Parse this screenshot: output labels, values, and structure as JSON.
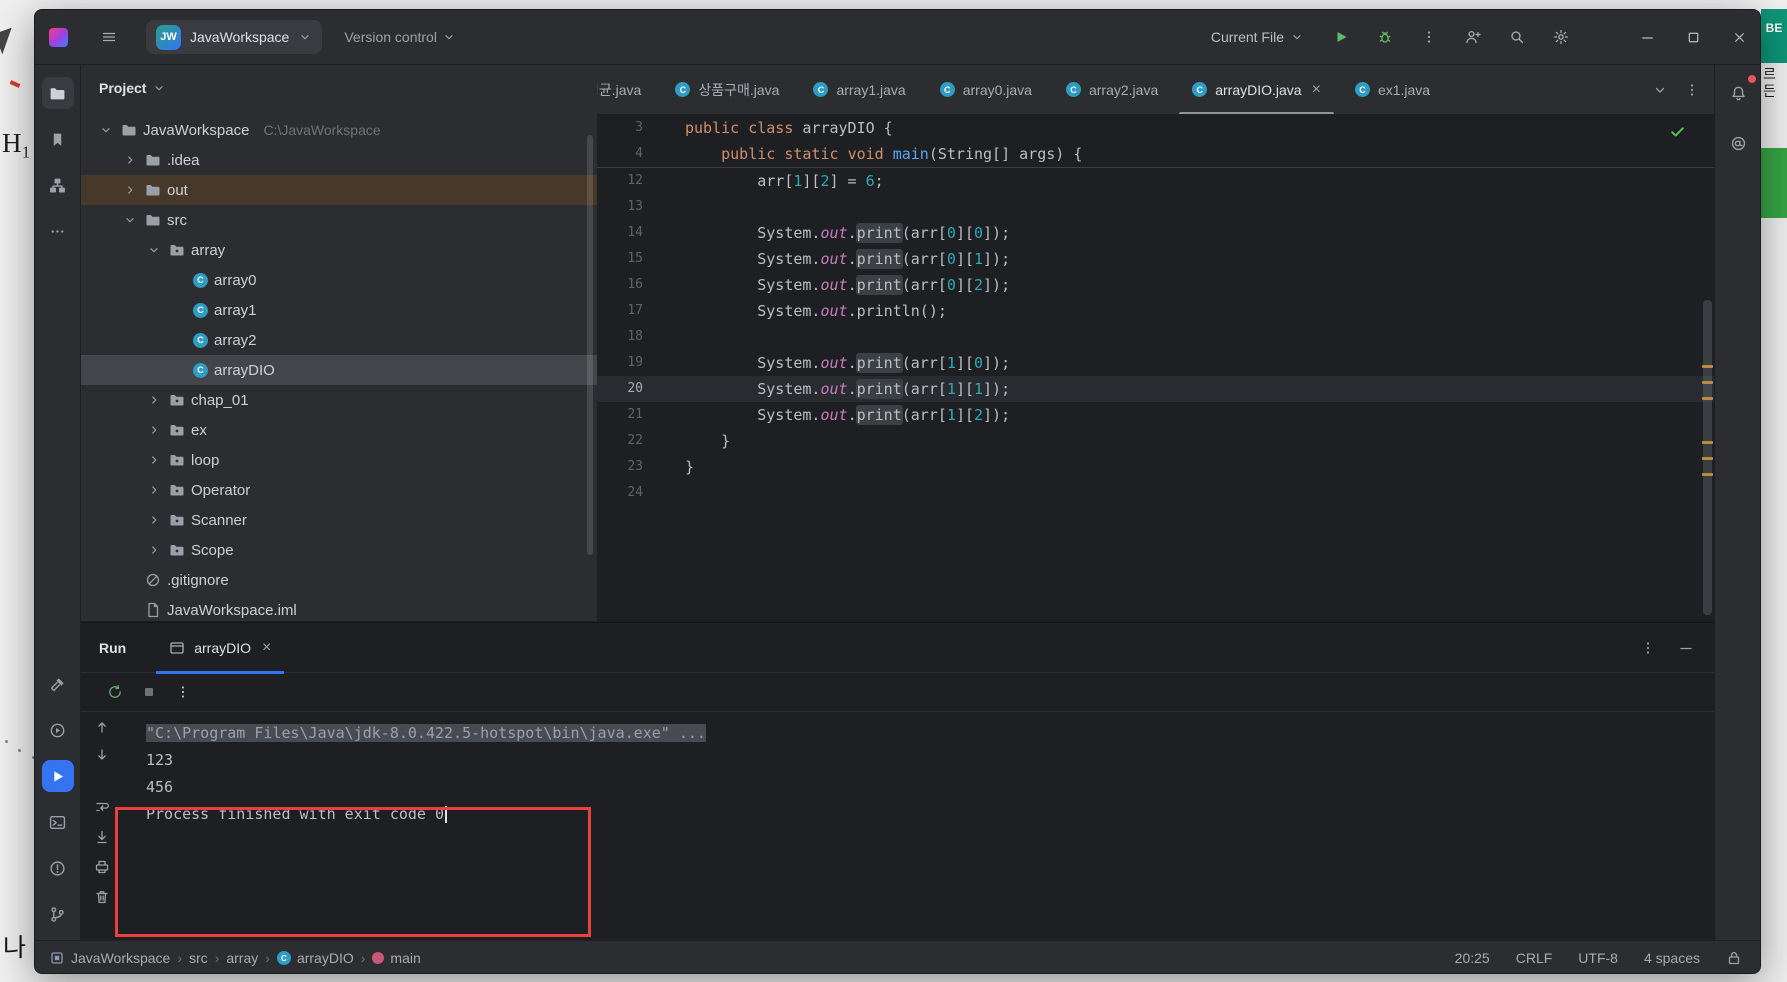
{
  "colors": {
    "accent_blue": "#3574f0",
    "keyword": "#cf8e6d",
    "number": "#2aacb8",
    "field": "#c77dbb",
    "method_decl": "#56a8f5",
    "annotation_red": "#e8403c",
    "run_green": "#5fb865",
    "check_green": "#57c457",
    "class_icon_blue": "#2e9cc3",
    "tree_selection": "#43454a",
    "out_row": "#47392a",
    "selection_console": "#474b52"
  },
  "titlebar": {
    "project_name": "JavaWorkspace",
    "project_avatar": "JW",
    "version_control_label": "Version control",
    "run_config_label": "Current File",
    "right_icons": [
      {
        "icon": "run",
        "name": "run-button",
        "cls": "green"
      },
      {
        "icon": "debug",
        "name": "debug-button",
        "cls": "green"
      },
      {
        "icon": "more-vertical",
        "name": "more-actions-button",
        "cls": ""
      },
      {
        "icon": "user-plus",
        "name": "code-with-me-button",
        "cls": ""
      },
      {
        "icon": "search",
        "name": "search-everywhere-button",
        "cls": ""
      },
      {
        "icon": "settings",
        "name": "settings-button",
        "cls": ""
      }
    ]
  },
  "left_stripe": {
    "top": [
      {
        "icon": "folder",
        "name": "project-tool-button",
        "active": true
      },
      {
        "icon": "bookmark",
        "name": "bookmarks-tool-button"
      },
      {
        "icon": "structure",
        "name": "structure-tool-button"
      },
      {
        "icon": "more-horizontal",
        "name": "more-tool-windows-button"
      }
    ],
    "bottom": [
      {
        "icon": "build",
        "name": "build-tool-button"
      },
      {
        "icon": "services",
        "name": "services-tool-button"
      },
      {
        "icon": "run-filled",
        "name": "run-tool-button",
        "accent": true
      },
      {
        "icon": "terminal",
        "name": "terminal-tool-button"
      },
      {
        "icon": "problems",
        "name": "problems-tool-button"
      },
      {
        "icon": "branch",
        "name": "version-control-tool-button"
      }
    ]
  },
  "right_stripe": {
    "icons": [
      {
        "icon": "bell",
        "name": "notifications-button",
        "badge": true
      },
      {
        "icon": "ai",
        "name": "ai-assistant-button"
      }
    ]
  },
  "project_panel": {
    "header": "Project",
    "tree": [
      {
        "label": "JavaWorkspace",
        "note": "C:\\JavaWorkspace",
        "depth": 0,
        "chevron": "down",
        "icon": "folder"
      },
      {
        "label": ".idea",
        "depth": 1,
        "chevron": "right",
        "icon": "folder"
      },
      {
        "label": "out",
        "depth": 1,
        "chevron": "right",
        "icon": "folder",
        "highlight": true
      },
      {
        "label": "src",
        "depth": 1,
        "chevron": "down",
        "icon": "folder"
      },
      {
        "label": "array",
        "depth": 2,
        "chevron": "down",
        "icon": "package"
      },
      {
        "label": "array0",
        "depth": 3,
        "icon": "class"
      },
      {
        "label": "array1",
        "depth": 3,
        "icon": "class"
      },
      {
        "label": "array2",
        "depth": 3,
        "icon": "class"
      },
      {
        "label": "arrayDIO",
        "depth": 3,
        "ic1on": "class",
        "icon": "class",
        "selected": true
      },
      {
        "label": "chap_01",
        "depth": 2,
        "chevron": "right",
        "icon": "package"
      },
      {
        "label": "ex",
        "depth": 2,
        "chevron": "right",
        "icon": "package"
      },
      {
        "label": "loop",
        "depth": 2,
        "chevron": "right",
        "icon": "package"
      },
      {
        "label": "Operator",
        "depth": 2,
        "chevron": "right",
        "icon": "package"
      },
      {
        "label": "Scanner",
        "depth": 2,
        "chevron": "right",
        "icon": "package"
      },
      {
        "label": "Scope",
        "depth": 2,
        "chevron": "right",
        "icon": "package"
      },
      {
        "label": ".gitignore",
        "depth": 1,
        "icon": "ignored"
      },
      {
        "label": "JavaWorkspace.iml",
        "depth": 1,
        "icon": "file"
      }
    ]
  },
  "editor": {
    "tabs": [
      {
        "label": "평균.java",
        "icon": false,
        "clipped": true
      },
      {
        "label": "상품구매.java",
        "icon": true
      },
      {
        "label": "array1.java",
        "icon": true
      },
      {
        "label": "array0.java",
        "icon": true
      },
      {
        "label": "array2.java",
        "icon": true
      },
      {
        "label": "arrayDIO.java",
        "icon": true,
        "active": true,
        "close": true
      },
      {
        "label": "ex1.java",
        "icon": true
      }
    ],
    "tabbar_icons": [
      {
        "icon": "chevron-down",
        "name": "hidden-tabs-chevron"
      },
      {
        "icon": "more-vertical",
        "name": "editor-options"
      }
    ],
    "sticky_lines": [
      {
        "num": "3",
        "seg": [
          [
            "k",
            "public"
          ],
          [
            "d",
            " "
          ],
          [
            "k",
            "class"
          ],
          [
            "d",
            " arrayDIO {"
          ]
        ]
      },
      {
        "num": "4",
        "seg": [
          [
            "d",
            "    "
          ],
          [
            "k",
            "public"
          ],
          [
            "d",
            " "
          ],
          [
            "k",
            "static"
          ],
          [
            "d",
            " "
          ],
          [
            "k",
            "void"
          ],
          [
            "d",
            " "
          ],
          [
            "m",
            "main"
          ],
          [
            "d",
            "(String[] args) {"
          ]
        ]
      }
    ],
    "lines": [
      {
        "num": "12",
        "seg": [
          [
            "d",
            "        arr["
          ],
          [
            "n",
            "1"
          ],
          [
            "d",
            "]["
          ],
          [
            "n",
            "2"
          ],
          [
            "d",
            "] = "
          ],
          [
            "n",
            "6"
          ],
          [
            "d",
            ";"
          ]
        ]
      },
      {
        "num": "13",
        "seg": []
      },
      {
        "num": "14",
        "seg": [
          [
            "d",
            "        System."
          ],
          [
            "f",
            "out"
          ],
          [
            "d",
            "."
          ],
          [
            "h",
            "print"
          ],
          [
            "d",
            "(arr["
          ],
          [
            "n",
            "0"
          ],
          [
            "d",
            "]["
          ],
          [
            "n",
            "0"
          ],
          [
            "d",
            "]);"
          ]
        ]
      },
      {
        "num": "15",
        "seg": [
          [
            "d",
            "        System."
          ],
          [
            "f",
            "out"
          ],
          [
            "d",
            "."
          ],
          [
            "h",
            "print"
          ],
          [
            "d",
            "(arr["
          ],
          [
            "n",
            "0"
          ],
          [
            "d",
            "]["
          ],
          [
            "n",
            "1"
          ],
          [
            "d",
            "]);"
          ]
        ]
      },
      {
        "num": "16",
        "seg": [
          [
            "d",
            "        System."
          ],
          [
            "f",
            "out"
          ],
          [
            "d",
            "."
          ],
          [
            "h",
            "print"
          ],
          [
            "d",
            "(arr["
          ],
          [
            "n",
            "0"
          ],
          [
            "d",
            "]["
          ],
          [
            "n",
            "2"
          ],
          [
            "d",
            "]);"
          ]
        ]
      },
      {
        "num": "17",
        "seg": [
          [
            "d",
            "        System."
          ],
          [
            "f",
            "out"
          ],
          [
            "d",
            ".println();"
          ]
        ]
      },
      {
        "num": "18",
        "seg": []
      },
      {
        "num": "19",
        "seg": [
          [
            "d",
            "        System."
          ],
          [
            "f",
            "out"
          ],
          [
            "d",
            "."
          ],
          [
            "h",
            "print"
          ],
          [
            "d",
            "(arr["
          ],
          [
            "n",
            "1"
          ],
          [
            "d",
            "]["
          ],
          [
            "n",
            "0"
          ],
          [
            "d",
            "]);"
          ]
        ]
      },
      {
        "num": "20",
        "cur": true,
        "seg": [
          [
            "d",
            "        System."
          ],
          [
            "f",
            "out"
          ],
          [
            "d",
            "."
          ],
          [
            "h",
            "print"
          ],
          [
            "d",
            "(arr["
          ],
          [
            "n",
            "1"
          ],
          [
            "d",
            "]["
          ],
          [
            "n",
            "1"
          ],
          [
            "d",
            "]);"
          ]
        ]
      },
      {
        "num": "21",
        "seg": [
          [
            "d",
            "        System."
          ],
          [
            "f",
            "out"
          ],
          [
            "d",
            "."
          ],
          [
            "h",
            "print"
          ],
          [
            "d",
            "(arr["
          ],
          [
            "n",
            "1"
          ],
          [
            "d",
            "]["
          ],
          [
            "n",
            "2"
          ],
          [
            "d",
            "]);"
          ]
        ]
      },
      {
        "num": "22",
        "seg": [
          [
            "d",
            "    }"
          ]
        ]
      },
      {
        "num": "23",
        "seg": [
          [
            "d",
            "}"
          ]
        ]
      },
      {
        "num": "24",
        "seg": []
      }
    ]
  },
  "run_panel": {
    "title": "Run",
    "tab_label": "arrayDIO",
    "toolbar_icons": [
      {
        "icon": "rerun",
        "name": "rerun-button",
        "cls": "green"
      },
      {
        "icon": "stop",
        "name": "stop-button",
        "cls": "dim"
      },
      {
        "icon": "more-vertical",
        "name": "more-options-button",
        "cls": ""
      }
    ],
    "header_icons": [
      {
        "icon": "more-vertical",
        "name": "run-panel-options-button"
      },
      {
        "icon": "minimize",
        "name": "hide-run-panel-button"
      }
    ],
    "gutter_icons": [
      {
        "icon": "scroll-up",
        "name": "scroll-up-button"
      },
      {
        "icon": "scroll-down",
        "name": "scroll-down-button"
      },
      {
        "icon": "soft-wrap",
        "name": "soft-wrap-button"
      },
      {
        "icon": "scroll-end",
        "name": "scroll-to-end-button"
      },
      {
        "icon": "printer",
        "name": "print-console-button"
      },
      {
        "icon": "trash",
        "name": "clear-console-button"
      }
    ],
    "console": [
      {
        "text": "\"C:\\Program Files\\Java\\jdk-8.0.422.5-hotspot\\bin\\java.exe\" ...",
        "selected": true
      },
      {
        "text": "123"
      },
      {
        "text": "456"
      },
      {
        "text": "Process finished with exit code 0",
        "caret": true
      }
    ]
  },
  "statusbar": {
    "breadcrumbs": [
      {
        "label": "JavaWorkspace",
        "icon": "project"
      },
      {
        "label": "src"
      },
      {
        "label": "array"
      },
      {
        "label": "arrayDIO",
        "icon": "class"
      },
      {
        "label": "main",
        "icon": "method"
      }
    ],
    "caret_position": "20:25",
    "line_ending": "CRLF",
    "encoding": "UTF-8",
    "indent": "4 spaces"
  },
  "background": {
    "top_left_text": "H₁",
    "bottom_left_text": "나",
    "right_badge_text": "BE",
    "right_side_text": "르든"
  }
}
